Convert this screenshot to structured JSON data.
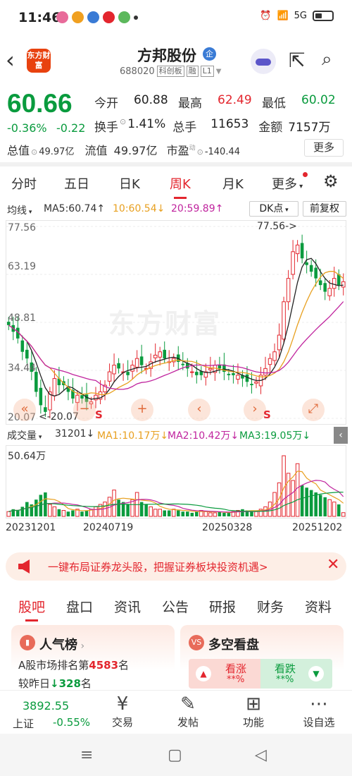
{
  "status": {
    "time": "11:46",
    "network": "5G"
  },
  "header": {
    "logo_text": "东方财富",
    "stock_name": "方邦股份",
    "badge": "企",
    "code": "688020",
    "tags": [
      "科创板",
      "融",
      "L1"
    ]
  },
  "quote": {
    "price": "60.66",
    "change_pct": "-0.36%",
    "change": "-0.22",
    "open_label": "今开",
    "open": "60.88",
    "high_label": "最高",
    "high": "62.49",
    "low_label": "最低",
    "low": "60.02",
    "turnover_label": "换手",
    "turnover": "1.41%",
    "volume_label": "总手",
    "volume": "11653",
    "amount_label": "金额",
    "amount": "7157万",
    "total_mv_label": "总值",
    "total_mv": "49.97亿",
    "float_mv_label": "流值",
    "float_mv": "49.97亿",
    "pe_label": "市盈",
    "pe_sup": "动",
    "pe": "-140.44",
    "more": "更多"
  },
  "tabs": [
    "分时",
    "五日",
    "日K",
    "周K",
    "月K",
    "更多"
  ],
  "indicators": {
    "ma_selector": "均线",
    "ma5": "MA5:60.74↑",
    "ma10": "10:60.54↓",
    "ma20": "20:59.89↑",
    "dk": "DK点",
    "adjust": "前复权"
  },
  "price_axis": [
    "77.56",
    "63.19",
    "48.81",
    "34.44",
    "20.07"
  ],
  "max_label": "77.56->",
  "min_label": "<-20.07",
  "watermark": "东方财富",
  "volume": {
    "selector": "成交量",
    "value": "31201↓",
    "ma1": "MA1:10.17万↓",
    "ma2": "MA2:10.42万↓",
    "ma3": "MA3:19.05万↓",
    "axis_max": "50.64万"
  },
  "dates": [
    "20231201",
    "20240719",
    "20250328",
    "20251202"
  ],
  "banner": {
    "text": "一键布局证券龙头股，把握证券板块投资机遇>"
  },
  "subtabs": [
    "股吧",
    "盘口",
    "资讯",
    "公告",
    "研报",
    "财务",
    "资料"
  ],
  "popularity": {
    "title": "人气榜",
    "rank_prefix": "A股市场排名第",
    "rank": "4583",
    "rank_suffix": "名",
    "cmp_prefix": "较昨日",
    "cmp": "328",
    "cmp_suffix": "名"
  },
  "longshort": {
    "title": "多空看盘",
    "bull": "看涨",
    "bull_val": "**%",
    "bear": "看跌",
    "bear_val": "**%"
  },
  "index": {
    "value": "3892.55",
    "name": "上证",
    "change": "-0.55%"
  },
  "nav": [
    {
      "label": "交易",
      "icon": "yen-icon"
    },
    {
      "label": "发帖",
      "icon": "edit-icon"
    },
    {
      "label": "功能",
      "icon": "grid-icon"
    },
    {
      "label": "设自选",
      "icon": "more-dots-icon"
    }
  ],
  "colors": {
    "up": "#e3262e",
    "down": "#0a9b3e",
    "ma10": "#e8a020",
    "ma20": "#c0249e"
  },
  "chart_data": {
    "type": "candlestick-weekly",
    "title": "方邦股份 周K",
    "ylim": [
      20.07,
      77.56
    ],
    "y_ticks": [
      77.56,
      63.19,
      48.81,
      34.44,
      20.07
    ],
    "x_ticks": [
      "20231201",
      "20240719",
      "20250328",
      "20251202"
    ],
    "close_series": [
      48,
      46,
      44,
      40,
      38,
      34,
      28,
      24,
      22,
      28,
      32,
      30,
      30,
      28,
      26,
      27,
      26,
      25,
      25,
      27,
      28,
      30,
      34,
      36,
      35,
      34,
      33,
      36,
      38,
      36,
      35,
      37,
      39,
      40,
      38,
      37,
      38,
      37,
      36,
      35,
      34,
      33,
      33,
      34,
      35,
      36,
      35,
      34,
      33,
      33,
      33,
      32,
      31,
      30,
      31,
      33,
      35,
      38,
      40,
      45,
      55,
      62,
      70,
      72,
      68,
      66,
      64,
      62,
      60,
      58,
      59,
      62,
      60,
      61
    ],
    "volume_wan": [
      4,
      6,
      5,
      8,
      12,
      10,
      14,
      18,
      20,
      10,
      8,
      6,
      5,
      4,
      5,
      6,
      4,
      5,
      6,
      8,
      10,
      12,
      16,
      22,
      14,
      12,
      10,
      14,
      20,
      12,
      10,
      8,
      6,
      6,
      5,
      5,
      6,
      5,
      4,
      4,
      3,
      4,
      5,
      4,
      3,
      3,
      4,
      3,
      3,
      4,
      5,
      6,
      5,
      4,
      4,
      6,
      8,
      12,
      20,
      28,
      50.64,
      36,
      30,
      44,
      26,
      24,
      22,
      20,
      18,
      16,
      14,
      12,
      10,
      3.12
    ]
  }
}
